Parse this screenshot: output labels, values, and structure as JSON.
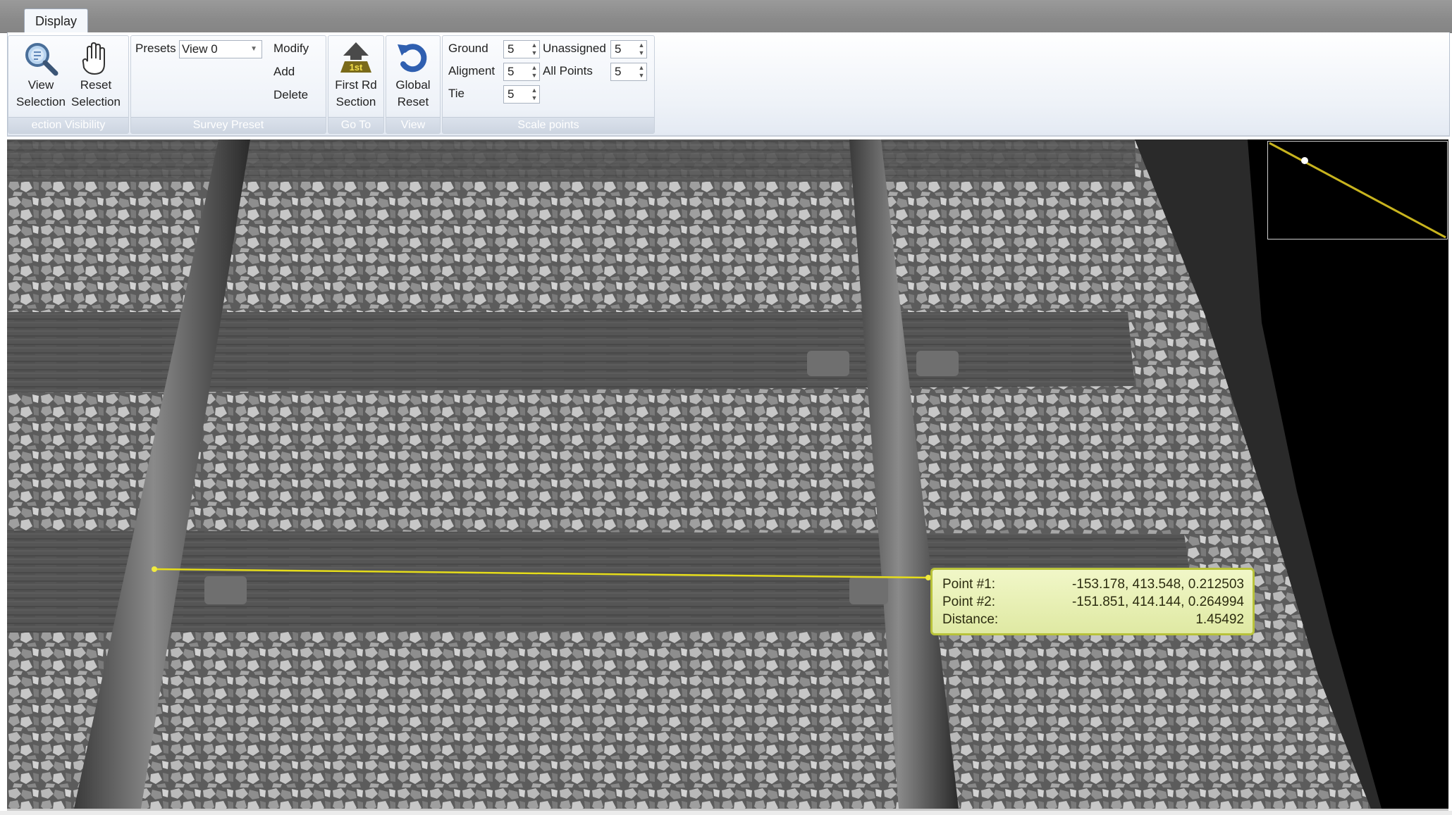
{
  "tabs": [
    {
      "label": "Display",
      "active": true
    }
  ],
  "ribbon": {
    "selection_visibility": {
      "group_label": "ection Visibility",
      "view_selection": {
        "line1": "View",
        "line2": "Selection",
        "icon": "magnifier-icon"
      },
      "reset_selection": {
        "line1": "Reset",
        "line2": "Selection",
        "icon": "hand-icon"
      }
    },
    "survey_preset": {
      "group_label": "Survey Preset",
      "presets_label": "Presets",
      "presets_value": "View 0",
      "modify": "Modify",
      "add": "Add",
      "delete": "Delete"
    },
    "go_to": {
      "group_label": "Go To",
      "first_rd_section": {
        "line1": "First Rd",
        "line2": "Section",
        "icon": "first-road-section-icon",
        "icon_text": "1st"
      }
    },
    "view": {
      "group_label": "View",
      "global_reset": {
        "line1": "Global",
        "line2": "Reset",
        "icon": "rotate-reset-icon"
      }
    },
    "scale_points": {
      "group_label": "Scale points",
      "ground": {
        "label": "Ground",
        "value": "5"
      },
      "unassigned": {
        "label": "Unassigned",
        "value": "5"
      },
      "alignment": {
        "label": "Aligment",
        "value": "5"
      },
      "all_points": {
        "label": "All Points",
        "value": "5"
      },
      "tie": {
        "label": "Tie",
        "value": "5"
      }
    }
  },
  "measurement": {
    "point1_label": "Point #1:",
    "point1_value": "-153.178, 413.548, 0.212503",
    "point2_label": "Point #2:",
    "point2_value": "-151.851, 414.144, 0.264994",
    "distance_label": "Distance:",
    "distance_value": "1.45492",
    "line_color": "#e6dd1a",
    "label_bg": "#e8f0b0"
  },
  "colors": {
    "tabstrip": "#8f8f8f",
    "ribbon_group_label_text": "#ffffff",
    "minimap_track": "#c8b41e"
  }
}
